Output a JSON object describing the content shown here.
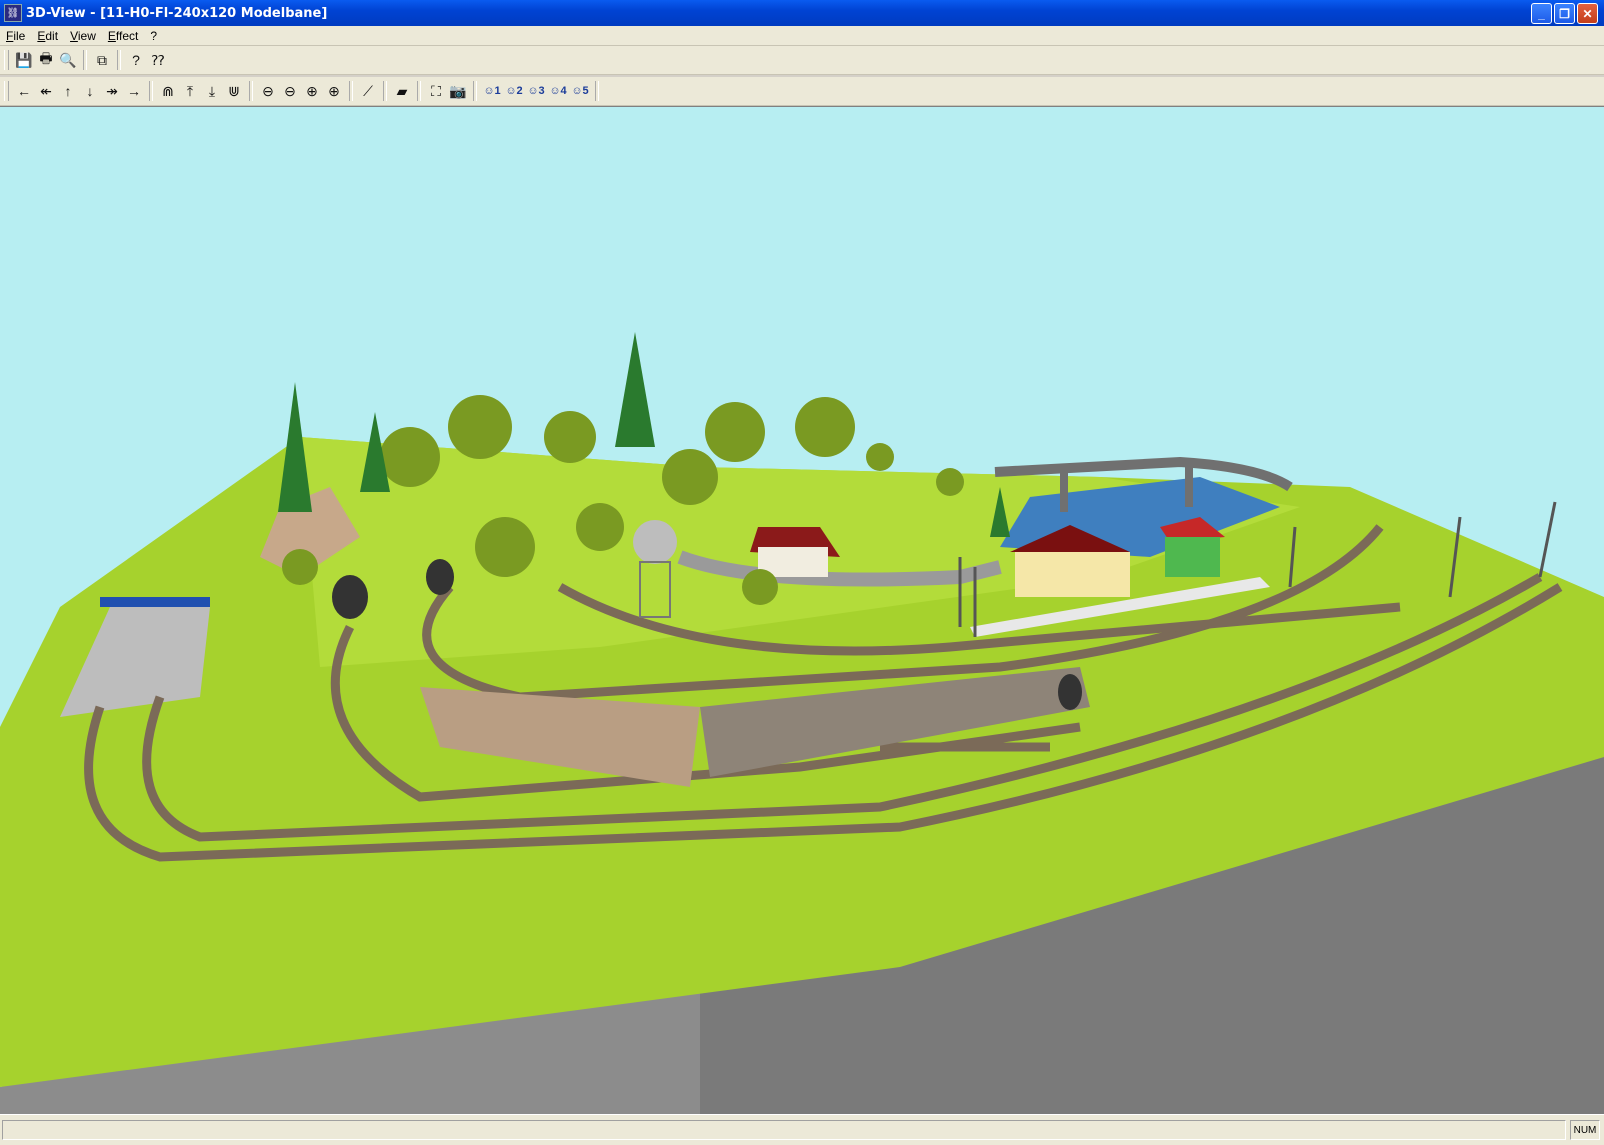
{
  "window": {
    "title": "3D-View - [11-H0-Fl-240x120 Modelbane]",
    "buttons": [
      "minimize",
      "maximize",
      "close"
    ]
  },
  "menu": [
    {
      "label": "File"
    },
    {
      "label": "Edit"
    },
    {
      "label": "View"
    },
    {
      "label": "Effect"
    },
    {
      "label": "?"
    }
  ],
  "toolbar1": [
    {
      "name": "save-icon",
      "glyph": "💾"
    },
    {
      "name": "print-icon",
      "glyph": "🖶"
    },
    {
      "name": "print-preview-icon",
      "glyph": "🔍"
    },
    {
      "name": "copy-icon",
      "glyph": "⧉"
    },
    {
      "name": "help-icon",
      "glyph": "?"
    },
    {
      "name": "context-help-icon",
      "glyph": "⁇"
    }
  ],
  "toolbar2": {
    "nav": [
      {
        "name": "move-left-icon",
        "glyph": "←"
      },
      {
        "name": "rotate-left-icon",
        "glyph": "↞"
      },
      {
        "name": "move-up-icon",
        "glyph": "↑"
      },
      {
        "name": "move-down-icon",
        "glyph": "↓"
      },
      {
        "name": "rotate-right-icon",
        "glyph": "↠"
      },
      {
        "name": "move-right-icon",
        "glyph": "→"
      }
    ],
    "view": [
      {
        "name": "view-tilt-icon",
        "glyph": "⋒"
      },
      {
        "name": "view-raise-icon",
        "glyph": "⤒"
      },
      {
        "name": "view-lower-icon",
        "glyph": "⤓"
      },
      {
        "name": "view-level-icon",
        "glyph": "⋓"
      }
    ],
    "zoom": [
      {
        "name": "zoom-out-icon",
        "glyph": "⊖"
      },
      {
        "name": "zoom-out-small-icon",
        "glyph": "⊖"
      },
      {
        "name": "zoom-in-icon",
        "glyph": "⊕"
      },
      {
        "name": "zoom-in-large-icon",
        "glyph": "⊕"
      }
    ],
    "tools": [
      {
        "name": "track-tool-icon",
        "glyph": "⟋"
      },
      {
        "name": "terrain-tool-icon",
        "glyph": "▰"
      },
      {
        "name": "fit-view-icon",
        "glyph": "⛶"
      },
      {
        "name": "camera-icon",
        "glyph": "📷"
      }
    ],
    "cameras": [
      "1",
      "2",
      "3",
      "4",
      "5"
    ]
  },
  "status": {
    "main": "",
    "num": "NUM"
  },
  "colors": {
    "sky": "#b7eef2",
    "grass": "#a4d42c",
    "cliff": "#8a8a8a",
    "track": "#7a6a5a",
    "water": "#3f7fbf"
  }
}
